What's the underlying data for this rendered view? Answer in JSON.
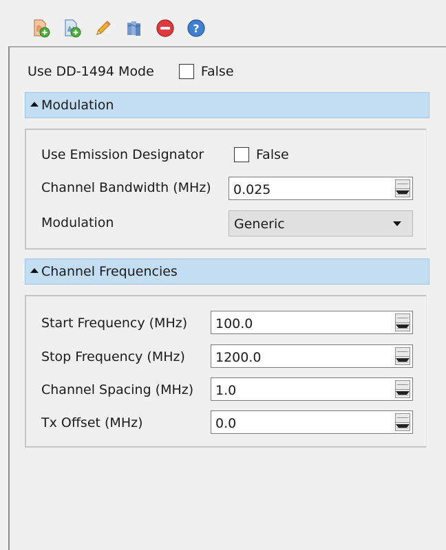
{
  "toolbar": {
    "buttons": [
      {
        "icon": "add-document-icon",
        "tooltip": ""
      },
      {
        "icon": "add-copy-icon",
        "tooltip": ""
      },
      {
        "icon": "pencil-edit-icon",
        "tooltip": ""
      },
      {
        "icon": "multi-document-icon",
        "tooltip": ""
      },
      {
        "icon": "remove-icon",
        "tooltip": ""
      },
      {
        "icon": "help-icon",
        "tooltip": ""
      }
    ]
  },
  "dd1494": {
    "label": "Use DD-1494 Mode",
    "checked": false,
    "value_text": "False"
  },
  "modulation_section": {
    "title": "Modulation",
    "use_emission": {
      "label": "Use Emission Designator",
      "checked": false,
      "value_text": "False"
    },
    "bandwidth": {
      "label": "Channel Bandwidth (MHz)",
      "value": "0.025"
    },
    "modulation": {
      "label": "Modulation",
      "value": "Generic"
    }
  },
  "frequencies_section": {
    "title": "Channel Frequencies",
    "start": {
      "label": "Start Frequency (MHz)",
      "value": "100.0"
    },
    "stop": {
      "label": "Stop Frequency (MHz)",
      "value": "1200.0"
    },
    "spacing": {
      "label": "Channel Spacing (MHz)",
      "value": "1.0"
    },
    "tx_offset": {
      "label": "Tx Offset (MHz)",
      "value": "0.0"
    }
  },
  "colors": {
    "section_header_bg": "#c3def3",
    "panel_bg": "#f0f0f0",
    "remove_icon": "#e0393e",
    "help_icon": "#3f7fcf"
  }
}
